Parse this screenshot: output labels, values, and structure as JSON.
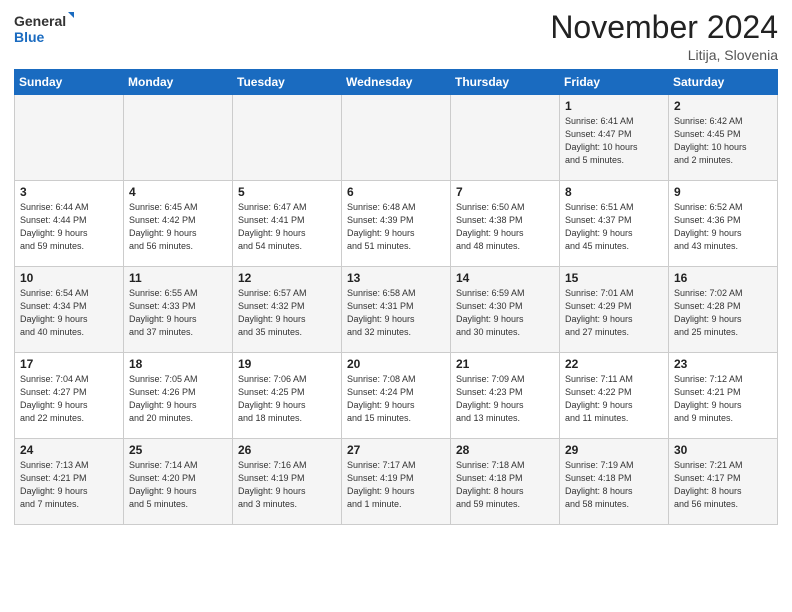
{
  "logo": {
    "general": "General",
    "blue": "Blue"
  },
  "title": "November 2024",
  "location": "Litija, Slovenia",
  "days_header": [
    "Sunday",
    "Monday",
    "Tuesday",
    "Wednesday",
    "Thursday",
    "Friday",
    "Saturday"
  ],
  "weeks": [
    [
      {
        "day": "",
        "info": ""
      },
      {
        "day": "",
        "info": ""
      },
      {
        "day": "",
        "info": ""
      },
      {
        "day": "",
        "info": ""
      },
      {
        "day": "",
        "info": ""
      },
      {
        "day": "1",
        "info": "Sunrise: 6:41 AM\nSunset: 4:47 PM\nDaylight: 10 hours\nand 5 minutes."
      },
      {
        "day": "2",
        "info": "Sunrise: 6:42 AM\nSunset: 4:45 PM\nDaylight: 10 hours\nand 2 minutes."
      }
    ],
    [
      {
        "day": "3",
        "info": "Sunrise: 6:44 AM\nSunset: 4:44 PM\nDaylight: 9 hours\nand 59 minutes."
      },
      {
        "day": "4",
        "info": "Sunrise: 6:45 AM\nSunset: 4:42 PM\nDaylight: 9 hours\nand 56 minutes."
      },
      {
        "day": "5",
        "info": "Sunrise: 6:47 AM\nSunset: 4:41 PM\nDaylight: 9 hours\nand 54 minutes."
      },
      {
        "day": "6",
        "info": "Sunrise: 6:48 AM\nSunset: 4:39 PM\nDaylight: 9 hours\nand 51 minutes."
      },
      {
        "day": "7",
        "info": "Sunrise: 6:50 AM\nSunset: 4:38 PM\nDaylight: 9 hours\nand 48 minutes."
      },
      {
        "day": "8",
        "info": "Sunrise: 6:51 AM\nSunset: 4:37 PM\nDaylight: 9 hours\nand 45 minutes."
      },
      {
        "day": "9",
        "info": "Sunrise: 6:52 AM\nSunset: 4:36 PM\nDaylight: 9 hours\nand 43 minutes."
      }
    ],
    [
      {
        "day": "10",
        "info": "Sunrise: 6:54 AM\nSunset: 4:34 PM\nDaylight: 9 hours\nand 40 minutes."
      },
      {
        "day": "11",
        "info": "Sunrise: 6:55 AM\nSunset: 4:33 PM\nDaylight: 9 hours\nand 37 minutes."
      },
      {
        "day": "12",
        "info": "Sunrise: 6:57 AM\nSunset: 4:32 PM\nDaylight: 9 hours\nand 35 minutes."
      },
      {
        "day": "13",
        "info": "Sunrise: 6:58 AM\nSunset: 4:31 PM\nDaylight: 9 hours\nand 32 minutes."
      },
      {
        "day": "14",
        "info": "Sunrise: 6:59 AM\nSunset: 4:30 PM\nDaylight: 9 hours\nand 30 minutes."
      },
      {
        "day": "15",
        "info": "Sunrise: 7:01 AM\nSunset: 4:29 PM\nDaylight: 9 hours\nand 27 minutes."
      },
      {
        "day": "16",
        "info": "Sunrise: 7:02 AM\nSunset: 4:28 PM\nDaylight: 9 hours\nand 25 minutes."
      }
    ],
    [
      {
        "day": "17",
        "info": "Sunrise: 7:04 AM\nSunset: 4:27 PM\nDaylight: 9 hours\nand 22 minutes."
      },
      {
        "day": "18",
        "info": "Sunrise: 7:05 AM\nSunset: 4:26 PM\nDaylight: 9 hours\nand 20 minutes."
      },
      {
        "day": "19",
        "info": "Sunrise: 7:06 AM\nSunset: 4:25 PM\nDaylight: 9 hours\nand 18 minutes."
      },
      {
        "day": "20",
        "info": "Sunrise: 7:08 AM\nSunset: 4:24 PM\nDaylight: 9 hours\nand 15 minutes."
      },
      {
        "day": "21",
        "info": "Sunrise: 7:09 AM\nSunset: 4:23 PM\nDaylight: 9 hours\nand 13 minutes."
      },
      {
        "day": "22",
        "info": "Sunrise: 7:11 AM\nSunset: 4:22 PM\nDaylight: 9 hours\nand 11 minutes."
      },
      {
        "day": "23",
        "info": "Sunrise: 7:12 AM\nSunset: 4:21 PM\nDaylight: 9 hours\nand 9 minutes."
      }
    ],
    [
      {
        "day": "24",
        "info": "Sunrise: 7:13 AM\nSunset: 4:21 PM\nDaylight: 9 hours\nand 7 minutes."
      },
      {
        "day": "25",
        "info": "Sunrise: 7:14 AM\nSunset: 4:20 PM\nDaylight: 9 hours\nand 5 minutes."
      },
      {
        "day": "26",
        "info": "Sunrise: 7:16 AM\nSunset: 4:19 PM\nDaylight: 9 hours\nand 3 minutes."
      },
      {
        "day": "27",
        "info": "Sunrise: 7:17 AM\nSunset: 4:19 PM\nDaylight: 9 hours\nand 1 minute."
      },
      {
        "day": "28",
        "info": "Sunrise: 7:18 AM\nSunset: 4:18 PM\nDaylight: 8 hours\nand 59 minutes."
      },
      {
        "day": "29",
        "info": "Sunrise: 7:19 AM\nSunset: 4:18 PM\nDaylight: 8 hours\nand 58 minutes."
      },
      {
        "day": "30",
        "info": "Sunrise: 7:21 AM\nSunset: 4:17 PM\nDaylight: 8 hours\nand 56 minutes."
      }
    ]
  ]
}
